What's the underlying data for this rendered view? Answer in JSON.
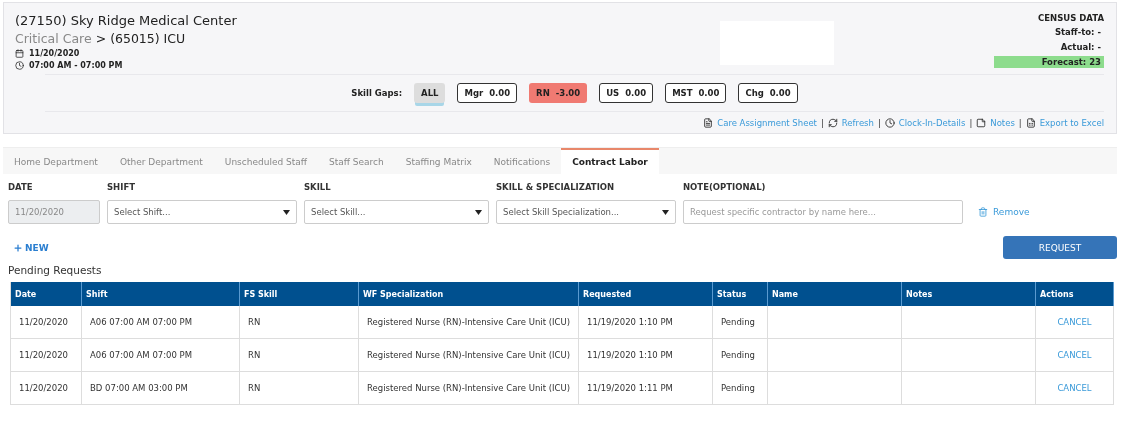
{
  "header": {
    "facility": "(27150) Sky Ridge Medical Center",
    "department_parent": "Critical Care",
    "breadcrumb_separator": ">",
    "department": "(65015) ICU",
    "date": "11/20/2020",
    "time_range": "07:00 AM - 07:00 PM"
  },
  "census": {
    "title": "CENSUS DATA",
    "rows": [
      {
        "text": "Staff-to: -",
        "highlight": false
      },
      {
        "text": "Actual: -",
        "highlight": false
      },
      {
        "text": "Forecast: 23",
        "highlight": true
      }
    ]
  },
  "skill_gaps": {
    "label": "Skill Gaps:",
    "items": [
      {
        "label": "ALL",
        "value": "",
        "selected": true,
        "alert": false
      },
      {
        "label": "Mgr",
        "value": "0.00",
        "selected": false,
        "alert": false
      },
      {
        "label": "RN",
        "value": "-3.00",
        "selected": false,
        "alert": true
      },
      {
        "label": "US",
        "value": "0.00",
        "selected": false,
        "alert": false
      },
      {
        "label": "MST",
        "value": "0.00",
        "selected": false,
        "alert": false
      },
      {
        "label": "Chg",
        "value": "0.00",
        "selected": false,
        "alert": false
      }
    ]
  },
  "links": [
    {
      "kind": "pdf",
      "label": "Care Assignment Sheet"
    },
    {
      "kind": "refresh",
      "label": "Refresh",
      "separator": "|"
    },
    {
      "kind": "clock",
      "label": "Clock-In-Details",
      "separator": "|"
    },
    {
      "kind": "note",
      "label": "Notes",
      "separator": "|"
    },
    {
      "kind": "excel",
      "label": "Export to Excel",
      "separator": "|"
    }
  ],
  "tabs": [
    {
      "label": "Home Department",
      "selected": false
    },
    {
      "label": "Other Department",
      "selected": false
    },
    {
      "label": "Unscheduled Staff",
      "selected": false
    },
    {
      "label": "Staff Search",
      "selected": false
    },
    {
      "label": "Staffing Matrix",
      "selected": false
    },
    {
      "label": "Notifications",
      "selected": false
    },
    {
      "label": "Contract Labor",
      "selected": true
    }
  ],
  "form": {
    "date": {
      "label": "DATE",
      "value": "11/20/2020",
      "disabled": true
    },
    "shift": {
      "label": "SHIFT",
      "placeholder": "Select Shift..."
    },
    "skill": {
      "label": "SKILL",
      "placeholder": "Select Skill..."
    },
    "specialization": {
      "label": "SKILL & SPECIALIZATION",
      "placeholder": "Select Skill Specialization..."
    },
    "note": {
      "label": "NOTE(OPTIONAL)",
      "placeholder": "Request specific contractor by name here..."
    },
    "remove": "Remove",
    "new": "NEW",
    "request": "REQUEST"
  },
  "pending": {
    "title": "Pending Requests",
    "columns": [
      "Date",
      "Shift",
      "FS Skill",
      "WF Specialization",
      "Requested",
      "Status",
      "Name",
      "Notes",
      "Actions"
    ],
    "rows": [
      {
        "date": "11/20/2020",
        "shift": "A06 07:00 AM 07:00 PM",
        "fs_skill": "RN",
        "wf_specialization": "Registered Nurse (RN)-Intensive Care Unit (ICU)",
        "requested": "11/19/2020 1:10 PM",
        "status": "Pending",
        "action": "CANCEL"
      },
      {
        "date": "11/20/2020",
        "shift": "A06 07:00 AM 07:00 PM",
        "fs_skill": "RN",
        "wf_specialization": "Registered Nurse (RN)-Intensive Care Unit (ICU)",
        "requested": "11/19/2020 1:10 PM",
        "status": "Pending",
        "action": "CANCEL"
      },
      {
        "date": "11/20/2020",
        "shift": "BD 07:00 AM 03:00 PM",
        "fs_skill": "RN",
        "wf_specialization": "Registered Nurse (RN)-Intensive Care Unit (ICU)",
        "requested": "11/19/2020 1:11 PM",
        "status": "Pending",
        "action": "CANCEL"
      }
    ]
  }
}
